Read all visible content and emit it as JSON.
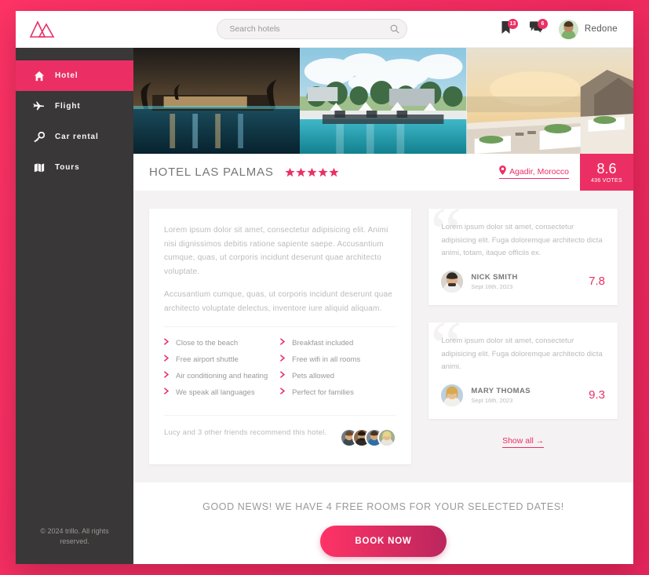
{
  "brand": {
    "logo_icon": "mountain-logo-icon",
    "accent": "#eb2f64",
    "dark": "#393737"
  },
  "search": {
    "placeholder": "Search hotels",
    "value": "",
    "icon": "search-icon"
  },
  "user_nav": {
    "bookmark": {
      "icon": "bookmark-icon",
      "badge": "13"
    },
    "messages": {
      "icon": "chat-icon",
      "badge": "6"
    },
    "user": {
      "name": "Redone",
      "avatar": "user-avatar"
    }
  },
  "sidebar": {
    "items": [
      {
        "label": "Hotel",
        "icon": "home-icon",
        "active": true
      },
      {
        "label": "Flight",
        "icon": "plane-icon",
        "active": false
      },
      {
        "label": "Car rental",
        "icon": "key-icon",
        "active": false
      },
      {
        "label": "Tours",
        "icon": "map-icon",
        "active": false
      }
    ],
    "legal": "© 2024 trillo. All rights reserved."
  },
  "gallery": [
    {
      "alt": "hotel-night-pool"
    },
    {
      "alt": "hotel-daytime-pool"
    },
    {
      "alt": "hotel-sunset-terrace"
    }
  ],
  "overview": {
    "heading": "Hotel Las Palmas",
    "stars": 5,
    "location": "Agadir, Morocco",
    "location_icon": "location-pin-icon",
    "rating_average": "8.6",
    "rating_count": "436 votes"
  },
  "description": {
    "paragraph_1": "Lorem ipsum dolor sit amet, consectetur adipisicing elit. Animi nisi dignissimos debitis ratione sapiente saepe. Accusantium cumque, quas, ut corporis incidunt deserunt quae architecto voluptate.",
    "paragraph_2": "Accusantium cumque, quas, ut corporis incidunt deserunt quae architecto voluptate delectus, inventore iure aliquid aliquam.",
    "features": [
      "Close to the beach",
      "Breakfast included",
      "Free airport shuttle",
      "Free wifi in all rooms",
      "Air conditioning and heating",
      "Pets allowed",
      "We speak all languages",
      "Perfect for families"
    ],
    "recommend_text": "Lucy and 3 other friends recommend this hotel.",
    "friend_count": 4
  },
  "reviews": [
    {
      "text": "Lorem ipsum dolor sit amet, consectetur adipisicing elit. Fuga doloremque architecto dicta animi, totam, itaque officiis ex.",
      "name": "Nick Smith",
      "date": "Sept 16th, 2023",
      "rating": "7.8"
    },
    {
      "text": "Lorem ipsum dolor sit amet, consectetur adipisicing elit. Fuga doloremque architecto dicta animi.",
      "name": "Mary Thomas",
      "date": "Sept 16th, 2023",
      "rating": "9.3"
    }
  ],
  "reviews_show_all": "Show all →",
  "cta": {
    "headline": "Good news! We have 4 free rooms for your selected dates!",
    "button": "Book now"
  }
}
